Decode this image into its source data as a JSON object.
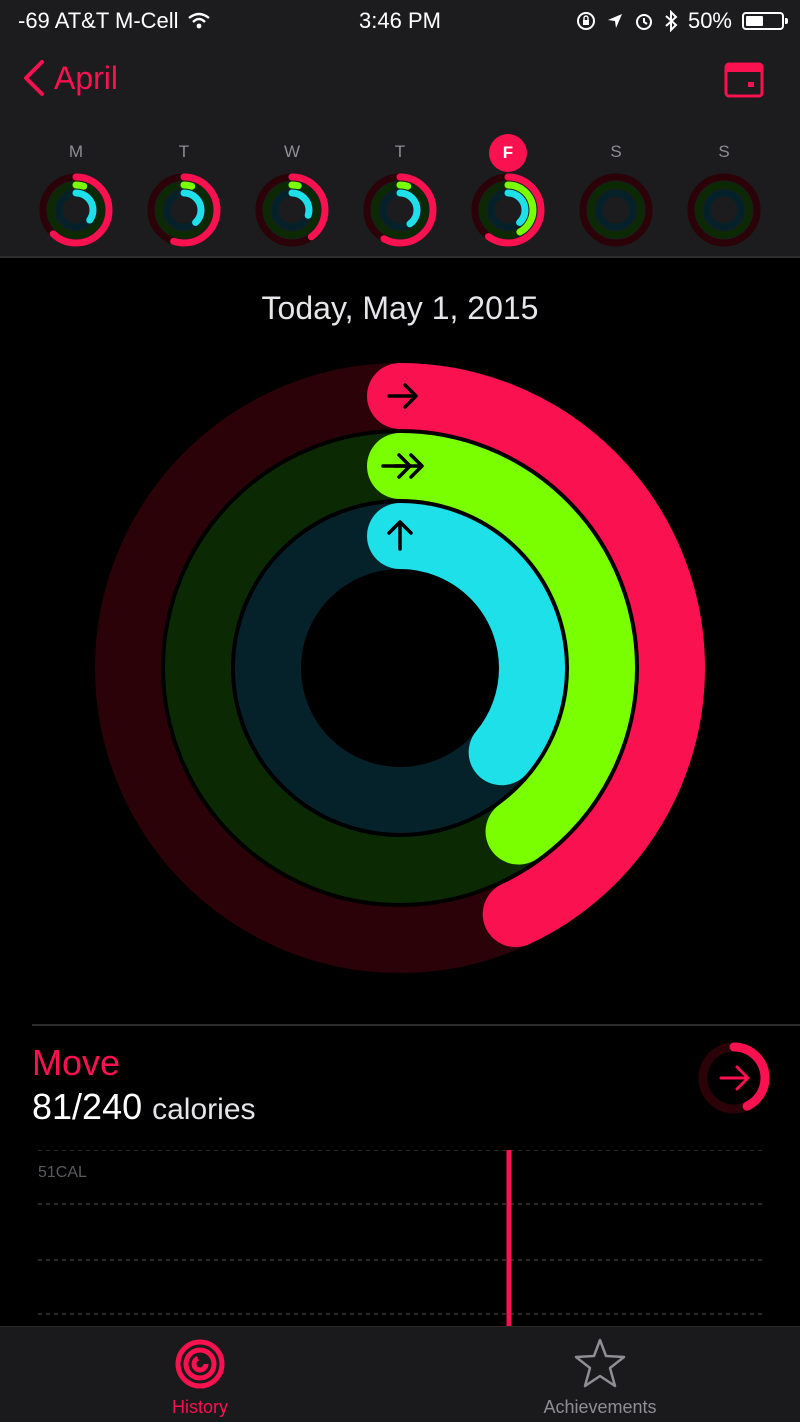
{
  "status": {
    "carrier": "-69 AT&T M-Cell",
    "time": "3:46 PM",
    "battery": "50%",
    "battery_level": 0.5
  },
  "nav": {
    "back_label": "April"
  },
  "week": {
    "days": [
      {
        "label": "M",
        "move": 0.62,
        "exercise": 0.05,
        "stand": 0.35,
        "selected": false
      },
      {
        "label": "T",
        "move": 0.55,
        "exercise": 0.05,
        "stand": 0.38,
        "selected": false
      },
      {
        "label": "W",
        "move": 0.4,
        "exercise": 0.04,
        "stand": 0.3,
        "selected": false
      },
      {
        "label": "T",
        "move": 0.58,
        "exercise": 0.05,
        "stand": 0.4,
        "selected": false
      },
      {
        "label": "F",
        "move": 0.6,
        "exercise": 0.42,
        "stand": 0.38,
        "selected": true
      },
      {
        "label": "S",
        "move": 0,
        "exercise": 0,
        "stand": 0,
        "selected": false
      },
      {
        "label": "S",
        "move": 0,
        "exercise": 0,
        "stand": 0,
        "selected": false
      }
    ]
  },
  "today": {
    "date_title": "Today, May 1, 2015",
    "move_progress": 0.43,
    "exercise_progress": 0.4,
    "stand_progress": 0.36
  },
  "move": {
    "title": "Move",
    "value": "81/240",
    "unit": "calories",
    "chart_label": "51CAL"
  },
  "tabs": [
    {
      "label": "History",
      "active": true
    },
    {
      "label": "Achievements",
      "active": false
    }
  ],
  "colors": {
    "move": "#fa114f",
    "move_track": "#2a0208",
    "exercise": "#7aff00",
    "exercise_track": "#0b2a03",
    "stand": "#1ee0e8",
    "stand_track": "#05222a",
    "bar_bg": "#1c1c1e"
  }
}
